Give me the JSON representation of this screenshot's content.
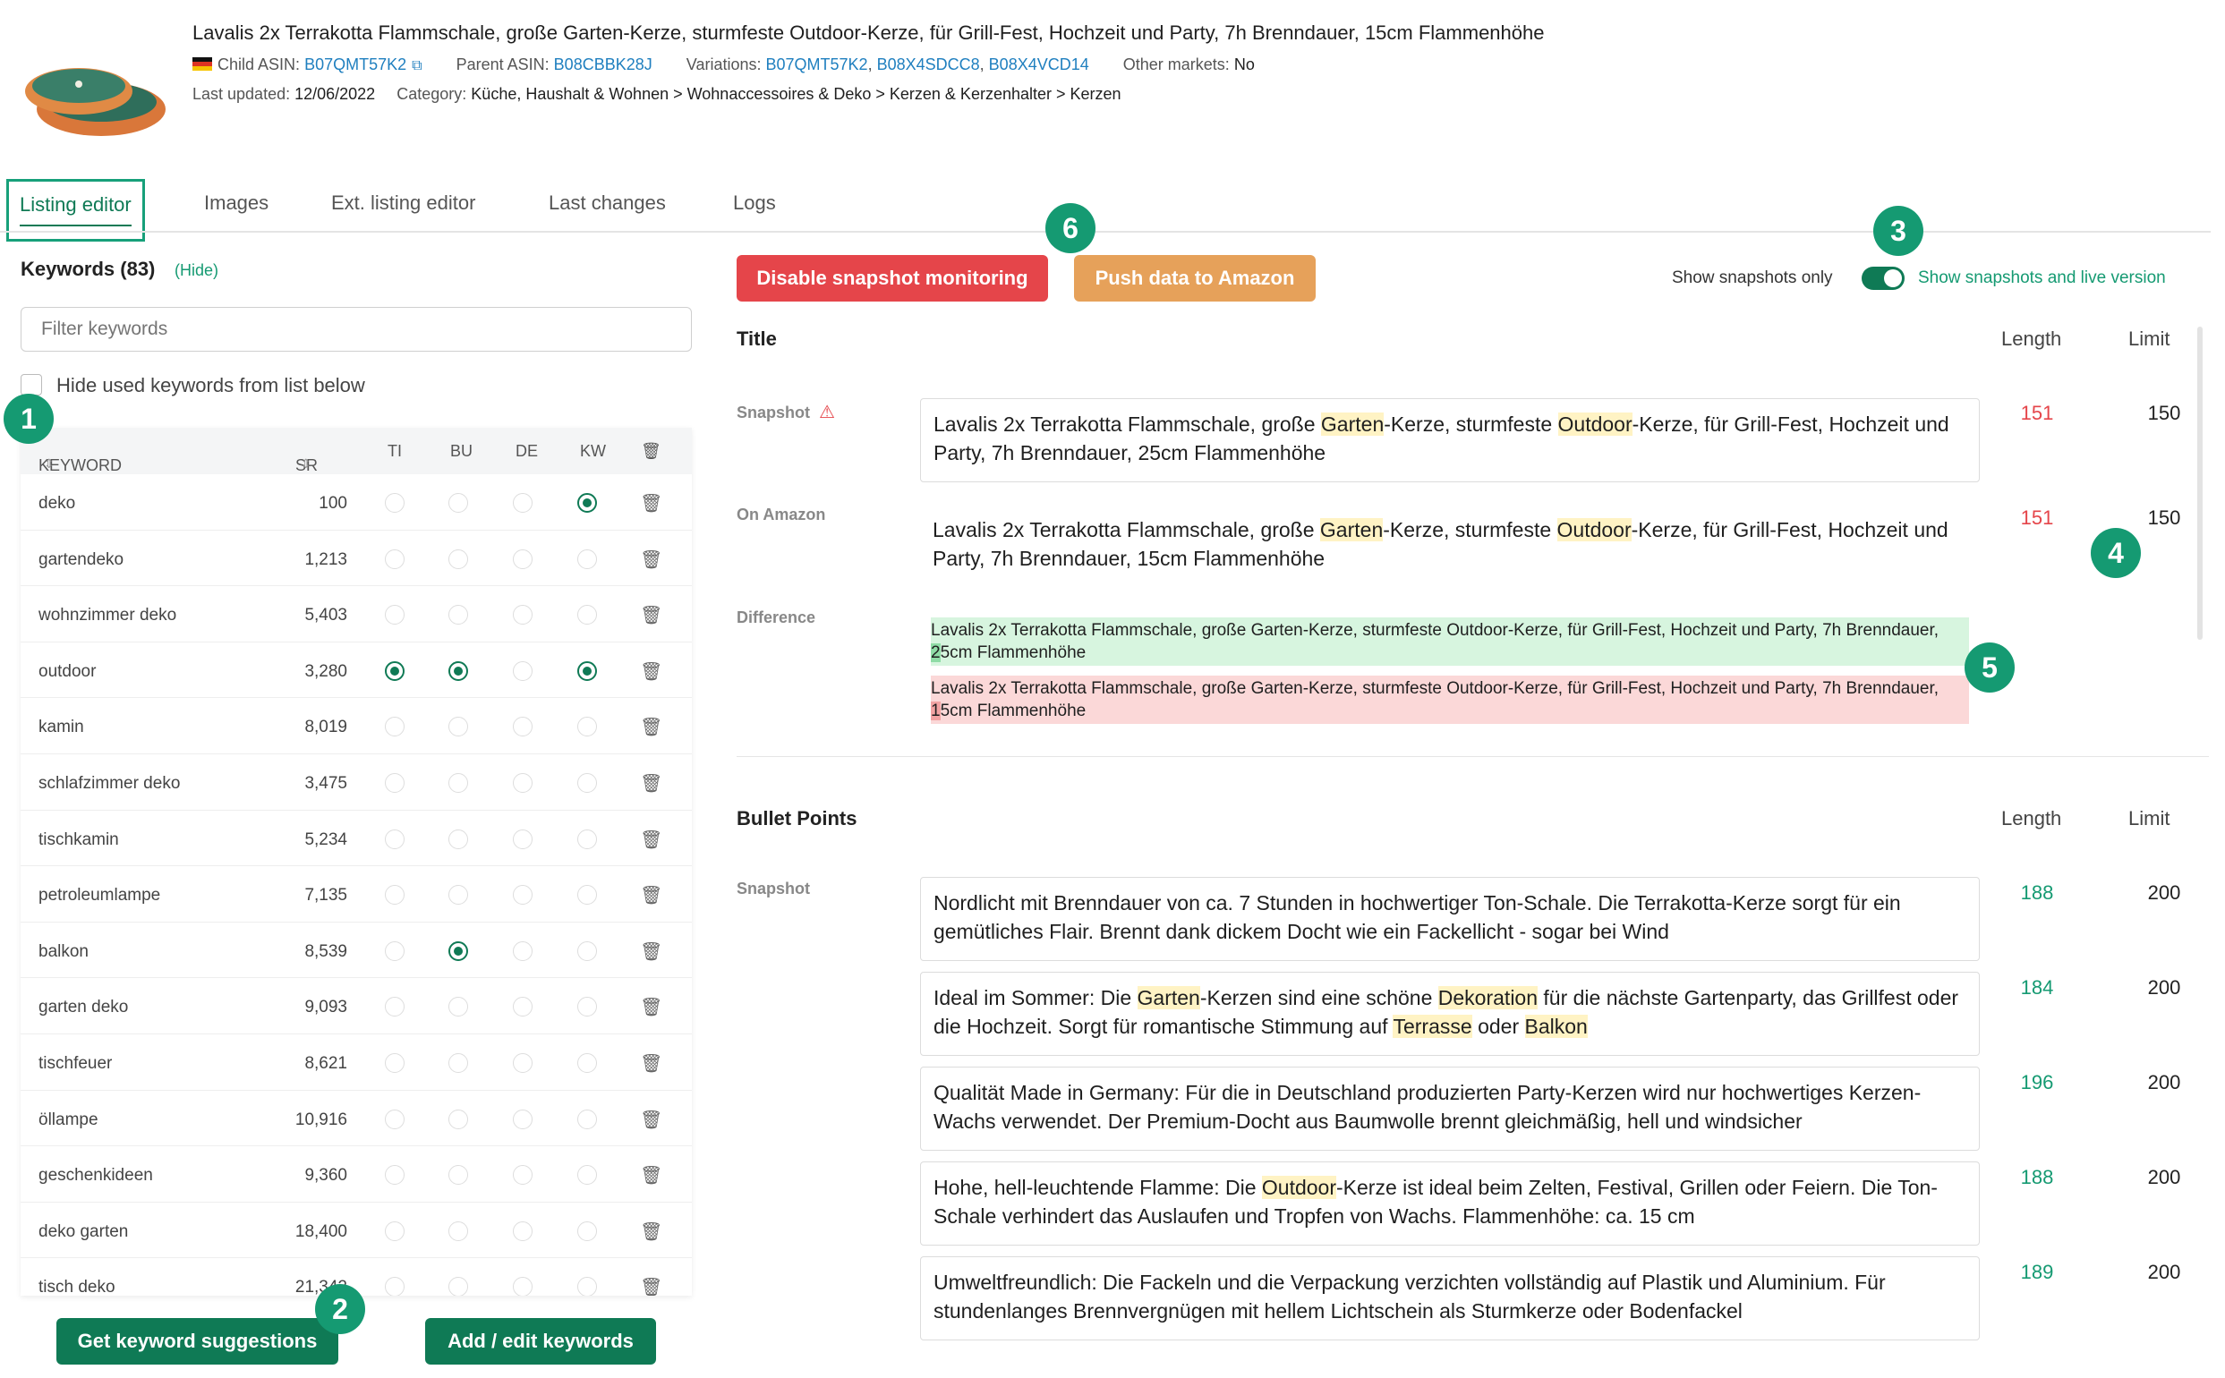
{
  "product": {
    "title": "Lavalis 2x Terrakotta Flammschale, große Garten-Kerze, sturmfeste Outdoor-Kerze, für Grill-Fest, Hochzeit und Party, 7h Brenndauer, 15cm Flammenhöhe",
    "child_asin_label": "Child ASIN:",
    "child_asin": "B07QMT57K2",
    "parent_asin_label": "Parent ASIN:",
    "parent_asin": "B08CBBK28J",
    "variations_label": "Variations:",
    "variations": [
      "B07QMT57K2",
      "B08X4SDCC8",
      "B08X4VCD14"
    ],
    "other_markets_label": "Other markets:",
    "other_markets": "No",
    "last_updated_label": "Last updated:",
    "last_updated": "12/06/2022",
    "category_label": "Category:",
    "category": "Küche, Haushalt & Wohnen > Wohnaccessoires & Deko > Kerzen & Kerzenhalter > Kerzen"
  },
  "tabs": [
    "Listing editor",
    "Images",
    "Ext. listing editor",
    "Last changes",
    "Logs"
  ],
  "keywords": {
    "title": "Keywords (83)",
    "hide_label": "(Hide)",
    "filter_placeholder": "Filter keywords",
    "hide_used_label": "Hide used keywords from list below",
    "columns": [
      "KEYWORD",
      "SR",
      "TI",
      "BU",
      "DE",
      "KW"
    ],
    "rows": [
      {
        "kw": "deko",
        "sr": "100",
        "ti": false,
        "bu": false,
        "de": false,
        "kwc": true
      },
      {
        "kw": "gartendeko",
        "sr": "1,213",
        "ti": false,
        "bu": false,
        "de": false,
        "kwc": false
      },
      {
        "kw": "wohnzimmer deko",
        "sr": "5,403",
        "ti": false,
        "bu": false,
        "de": false,
        "kwc": false
      },
      {
        "kw": "outdoor",
        "sr": "3,280",
        "ti": true,
        "bu": true,
        "de": false,
        "kwc": true
      },
      {
        "kw": "kamin",
        "sr": "8,019",
        "ti": false,
        "bu": false,
        "de": false,
        "kwc": false
      },
      {
        "kw": "schlafzimmer deko",
        "sr": "3,475",
        "ti": false,
        "bu": false,
        "de": false,
        "kwc": false
      },
      {
        "kw": "tischkamin",
        "sr": "5,234",
        "ti": false,
        "bu": false,
        "de": false,
        "kwc": false
      },
      {
        "kw": "petroleumlampe",
        "sr": "7,135",
        "ti": false,
        "bu": false,
        "de": false,
        "kwc": false
      },
      {
        "kw": "balkon",
        "sr": "8,539",
        "ti": false,
        "bu": true,
        "de": false,
        "kwc": false
      },
      {
        "kw": "garten deko",
        "sr": "9,093",
        "ti": false,
        "bu": false,
        "de": false,
        "kwc": false
      },
      {
        "kw": "tischfeuer",
        "sr": "8,621",
        "ti": false,
        "bu": false,
        "de": false,
        "kwc": false
      },
      {
        "kw": "öllampe",
        "sr": "10,916",
        "ti": false,
        "bu": false,
        "de": false,
        "kwc": false
      },
      {
        "kw": "geschenkideen",
        "sr": "9,360",
        "ti": false,
        "bu": false,
        "de": false,
        "kwc": false
      },
      {
        "kw": "deko garten",
        "sr": "18,400",
        "ti": false,
        "bu": false,
        "de": false,
        "kwc": false
      },
      {
        "kw": "tisch deko",
        "sr": "21,342",
        "ti": false,
        "bu": false,
        "de": false,
        "kwc": false
      }
    ],
    "suggest_button": "Get keyword suggestions",
    "add_button": "Add / edit keywords"
  },
  "toolbar": {
    "disable_button": "Disable snapshot monitoring",
    "push_button": "Push data to Amazon",
    "snapshots_only_label": "Show snapshots only",
    "snapshots_live_label": "Show snapshots and live version"
  },
  "title_section": {
    "heading": "Title",
    "length_label": "Length",
    "limit_label": "Limit",
    "snapshot_label": "Snapshot",
    "on_amazon_label": "On Amazon",
    "difference_label": "Difference",
    "snapshot_text": "Lavalis 2x Terrakotta Flammschale, große Garten-Kerze, sturmfeste Outdoor-Kerze, für Grill-Fest, Hochzeit und Party, 7h Brenndauer, 25cm Flammenhöhe",
    "snapshot_length": "151",
    "snapshot_limit": "150",
    "amazon_text": "Lavalis 2x Terrakotta Flammschale, große Garten-Kerze, sturmfeste Outdoor-Kerze, für Grill-Fest, Hochzeit und Party, 7h Brenndauer, 15cm Flammenhöhe",
    "amazon_length": "151",
    "amazon_limit": "150",
    "diff_added_pre": "Lavalis 2x Terrakotta Flammschale, große Garten-Kerze, sturmfeste Outdoor-Kerze, für Grill-Fest, Hochzeit und Party, 7h Brenndauer, ",
    "diff_added_mark": "2",
    "diff_added_post": "5cm Flammenhöhe",
    "diff_removed_pre": "Lavalis 2x Terrakotta Flammschale, große Garten-Kerze, sturmfeste Outdoor-Kerze, für Grill-Fest, Hochzeit und Party, 7h Brenndauer, ",
    "diff_removed_mark": "1",
    "diff_removed_post": "5cm Flammenhöhe"
  },
  "bullets_section": {
    "heading": "Bullet Points",
    "length_label": "Length",
    "limit_label": "Limit",
    "snapshot_label": "Snapshot",
    "bullets": [
      {
        "text": "Nordlicht mit Brenndauer von ca. 7 Stunden in hochwertiger Ton-Schale. Die Terrakotta-Kerze sorgt für ein gemütliches Flair. Brennt dank dickem Docht wie ein Fackellicht - sogar bei Wind",
        "length": "188",
        "limit": "200"
      },
      {
        "text": "Ideal im Sommer: Die Garten-Kerzen sind eine schöne Dekoration für die nächste Gartenparty, das Grillfest oder die Hochzeit. Sorgt für romantische Stimmung auf Terrasse oder Balkon",
        "length": "184",
        "limit": "200"
      },
      {
        "text": "Qualität Made in Germany: Für die in Deutschland produzierten Party-Kerzen wird nur hochwertiges Kerzen-Wachs verwendet. Der Premium-Docht aus Baumwolle brennt gleichmäßig, hell und windsicher",
        "length": "196",
        "limit": "200"
      },
      {
        "text": "Hohe, hell-leuchtende Flamme: Die Outdoor-Kerze ist ideal beim Zelten, Festival, Grillen oder Feiern. Die Ton-Schale verhindert das Auslaufen und Tropfen von Wachs. Flammenhöhe: ca. 15 cm",
        "length": "188",
        "limit": "200"
      },
      {
        "text": "Umweltfreundlich: Die Fackeln und die Verpackung verzichten vollständig auf Plastik und Aluminium. Für stundenlanges Brennvergnügen mit hellem Lichtschein als Sturmkerze oder Bodenfackel",
        "length": "189",
        "limit": "200"
      }
    ]
  },
  "badges": [
    "1",
    "2",
    "3",
    "4",
    "5",
    "6"
  ],
  "colors": {
    "accent": "#0f7a55",
    "badge": "#159a72",
    "danger": "#e5454a",
    "warning_button": "#e6a15a",
    "link": "#1f7fbf",
    "highlight": "#fff3c4"
  }
}
